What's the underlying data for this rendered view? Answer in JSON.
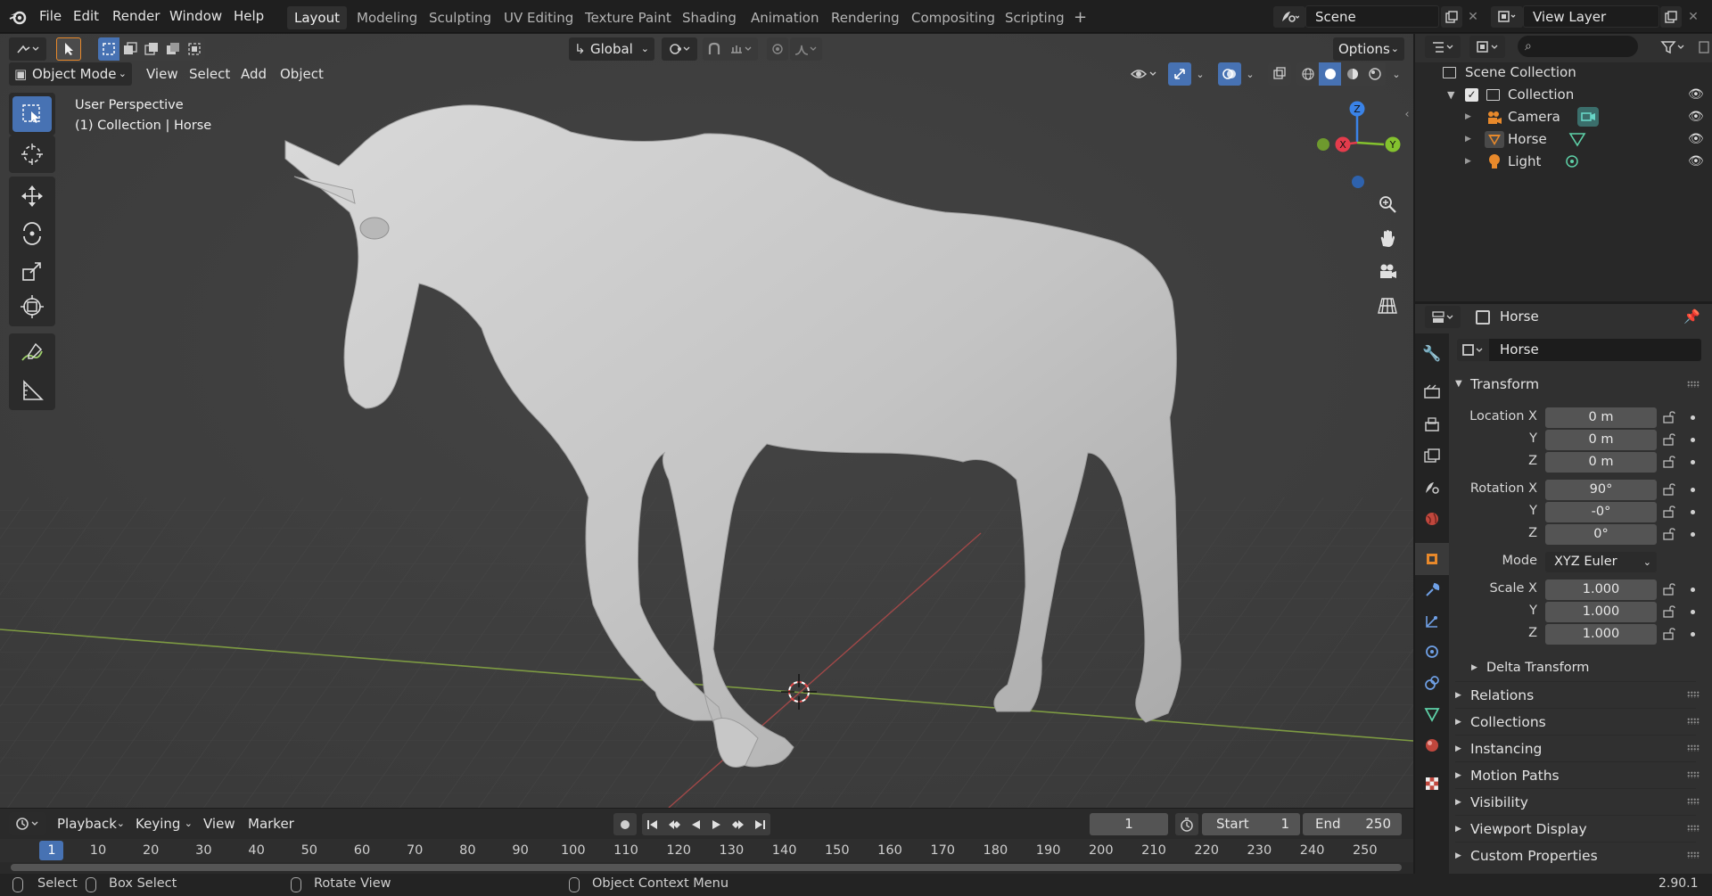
{
  "app": {
    "version": "2.90.1"
  },
  "menus": [
    "File",
    "Edit",
    "Render",
    "Window",
    "Help"
  ],
  "workspaces": [
    "Layout",
    "Modeling",
    "Sculpting",
    "UV Editing",
    "Texture Paint",
    "Shading",
    "Animation",
    "Rendering",
    "Compositing",
    "Scripting"
  ],
  "scene": {
    "name": "Scene",
    "view_layer": "View Layer"
  },
  "viewport": {
    "mode": "Object Mode",
    "header_menus": [
      "View",
      "Select",
      "Add",
      "Object"
    ],
    "transform_orientation": "Global",
    "options_label": "Options",
    "overlay_title": "User Perspective",
    "overlay_subtitle": "(1) Collection | Horse",
    "gizmo": {
      "z": "Z",
      "x": "X",
      "y": "Y"
    }
  },
  "outliner": {
    "search_placeholder": "",
    "root": "Scene Collection",
    "collection": "Collection",
    "items": [
      {
        "name": "Camera",
        "icon": "camera-icon"
      },
      {
        "name": "Horse",
        "icon": "mesh-icon"
      },
      {
        "name": "Light",
        "icon": "light-icon"
      }
    ]
  },
  "properties": {
    "context_name": "Horse",
    "object_name": "Horse",
    "transform_title": "Transform",
    "location": {
      "label_x": "Location X",
      "label_y": "Y",
      "label_z": "Z",
      "x": "0 m",
      "y": "0 m",
      "z": "0 m"
    },
    "rotation": {
      "label_x": "Rotation X",
      "label_y": "Y",
      "label_z": "Z",
      "x": "90°",
      "y": "-0°",
      "z": "0°"
    },
    "mode_label": "Mode",
    "mode_value": "XYZ Euler",
    "scale": {
      "label_x": "Scale X",
      "label_y": "Y",
      "label_z": "Z",
      "x": "1.000",
      "y": "1.000",
      "z": "1.000"
    },
    "delta_transform": "Delta Transform",
    "panels": [
      "Relations",
      "Collections",
      "Instancing",
      "Motion Paths",
      "Visibility",
      "Viewport Display",
      "Custom Properties"
    ]
  },
  "timeline": {
    "menus": [
      "Playback",
      "Keying",
      "View",
      "Marker"
    ],
    "current_frame": "1",
    "start_label": "Start",
    "start": "1",
    "end_label": "End",
    "end": "250",
    "ruler": [
      "1",
      "10",
      "20",
      "30",
      "40",
      "50",
      "60",
      "70",
      "80",
      "90",
      "100",
      "110",
      "120",
      "130",
      "140",
      "150",
      "160",
      "170",
      "180",
      "190",
      "200",
      "210",
      "220",
      "230",
      "240",
      "250"
    ]
  },
  "statusbar": {
    "select": "Select",
    "box_select": "Box Select",
    "rotate_view": "Rotate View",
    "context_menu": "Object Context Menu"
  },
  "colors": {
    "accent": "#4772b3",
    "active_orange": "#e8892b",
    "x_axis": "#e43c4c",
    "y_axis": "#84c22e",
    "z_axis": "#3a83e8"
  }
}
